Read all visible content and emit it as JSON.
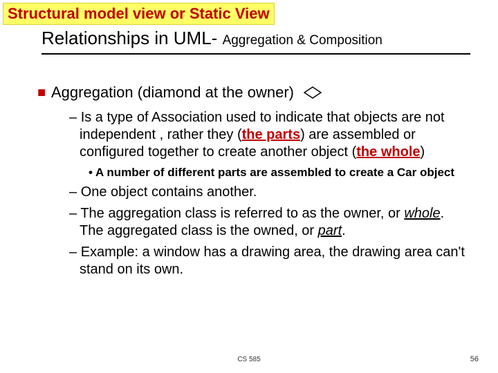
{
  "banner": "Structural model view or Static View",
  "title": {
    "main": "Relationships in UML- ",
    "sub": "Aggregation & Composition"
  },
  "lvl1": {
    "text": "Aggregation (diamond at the owner)",
    "icon_name": "uml-aggregation-diamond"
  },
  "lvl2_a": {
    "pre": "Is a type of Association used to indicate that objects are not independent , rather they (",
    "parts": "the parts",
    "mid": ") are assembled or configured together to create another object (",
    "whole": "the whole",
    "post": ")"
  },
  "lvl3_a": "A number of different parts are assembled to create a Car object",
  "lvl2_b": "One object contains another.",
  "lvl2_c": {
    "pre": "The aggregation class is referred to as the owner, or ",
    "whole": "whole",
    "mid": ". The aggregated class is the owned, or ",
    "part": "part",
    "post": "."
  },
  "lvl2_d": "Example: a window has a drawing area, the drawing area can't stand on its own.",
  "footer": {
    "course": "CS 585",
    "page": "56"
  }
}
